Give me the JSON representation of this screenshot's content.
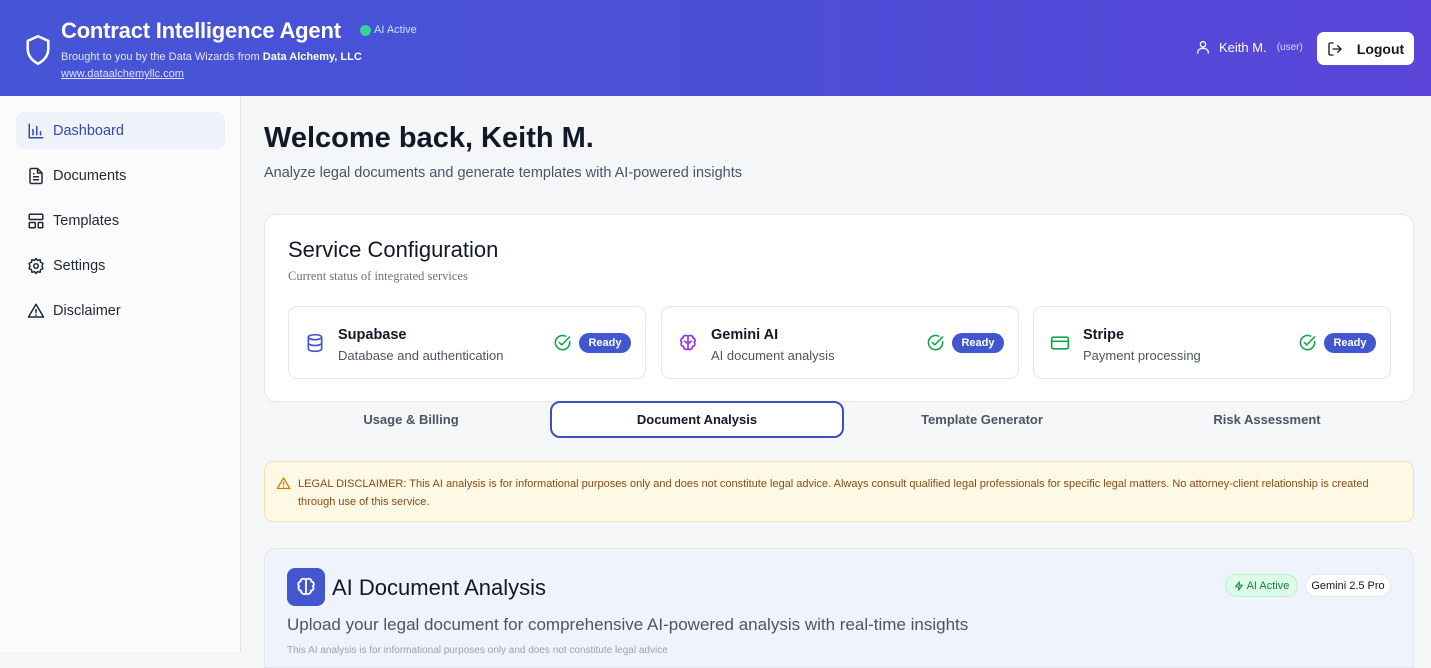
{
  "header": {
    "title": "Contract Intelligence Agent",
    "ai_status": "AI Active",
    "tagline_prefix": "Brought to you by the Data Wizards from ",
    "tagline_company": "Data Alchemy, LLC",
    "website": "www.dataalchemyllc.com",
    "user_name": "Keith M.",
    "user_role": "(user)",
    "logout_label": "Logout",
    "colors": {
      "gradient_start": "#4655d6",
      "gradient_end": "#5a45d8"
    }
  },
  "sidebar": {
    "items": [
      {
        "label": "Dashboard",
        "icon": "bar-chart-icon",
        "active": true
      },
      {
        "label": "Documents",
        "icon": "file-text-icon",
        "active": false
      },
      {
        "label": "Templates",
        "icon": "layout-icon",
        "active": false
      },
      {
        "label": "Settings",
        "icon": "gear-icon",
        "active": false
      },
      {
        "label": "Disclaimer",
        "icon": "warning-icon",
        "active": false
      }
    ]
  },
  "main": {
    "welcome": "Welcome back, Keith M.",
    "subtitle": "Analyze legal documents and generate templates with AI-powered insights",
    "service_config": {
      "title": "Service Configuration",
      "subtitle": "Current status of integrated services",
      "services": [
        {
          "name": "Supabase",
          "description": "Database and authentication",
          "status": "Ready",
          "icon": "database-icon"
        },
        {
          "name": "Gemini AI",
          "description": "AI document analysis",
          "status": "Ready",
          "icon": "brain-icon"
        },
        {
          "name": "Stripe",
          "description": "Payment processing",
          "status": "Ready",
          "icon": "credit-card-icon"
        }
      ]
    },
    "tabs": [
      {
        "label": "Usage & Billing",
        "active": false
      },
      {
        "label": "Document Analysis",
        "active": true
      },
      {
        "label": "Template Generator",
        "active": false
      },
      {
        "label": "Risk Assessment",
        "active": false
      }
    ],
    "disclaimer": "LEGAL DISCLAIMER: This AI analysis is for informational purposes only and does not constitute legal advice. Always consult qualified legal professionals for specific legal matters. No attorney-client relationship is created through use of this service.",
    "analysis": {
      "title": "AI Document Analysis",
      "subtitle": "Upload your legal document for comprehensive AI-powered analysis with real-time insights",
      "ai_badge": "AI Active",
      "model_badge": "Gemini 2.5 Pro",
      "clipped_note": "This AI analysis is for informational purposes only and does not constitute legal advice"
    }
  }
}
